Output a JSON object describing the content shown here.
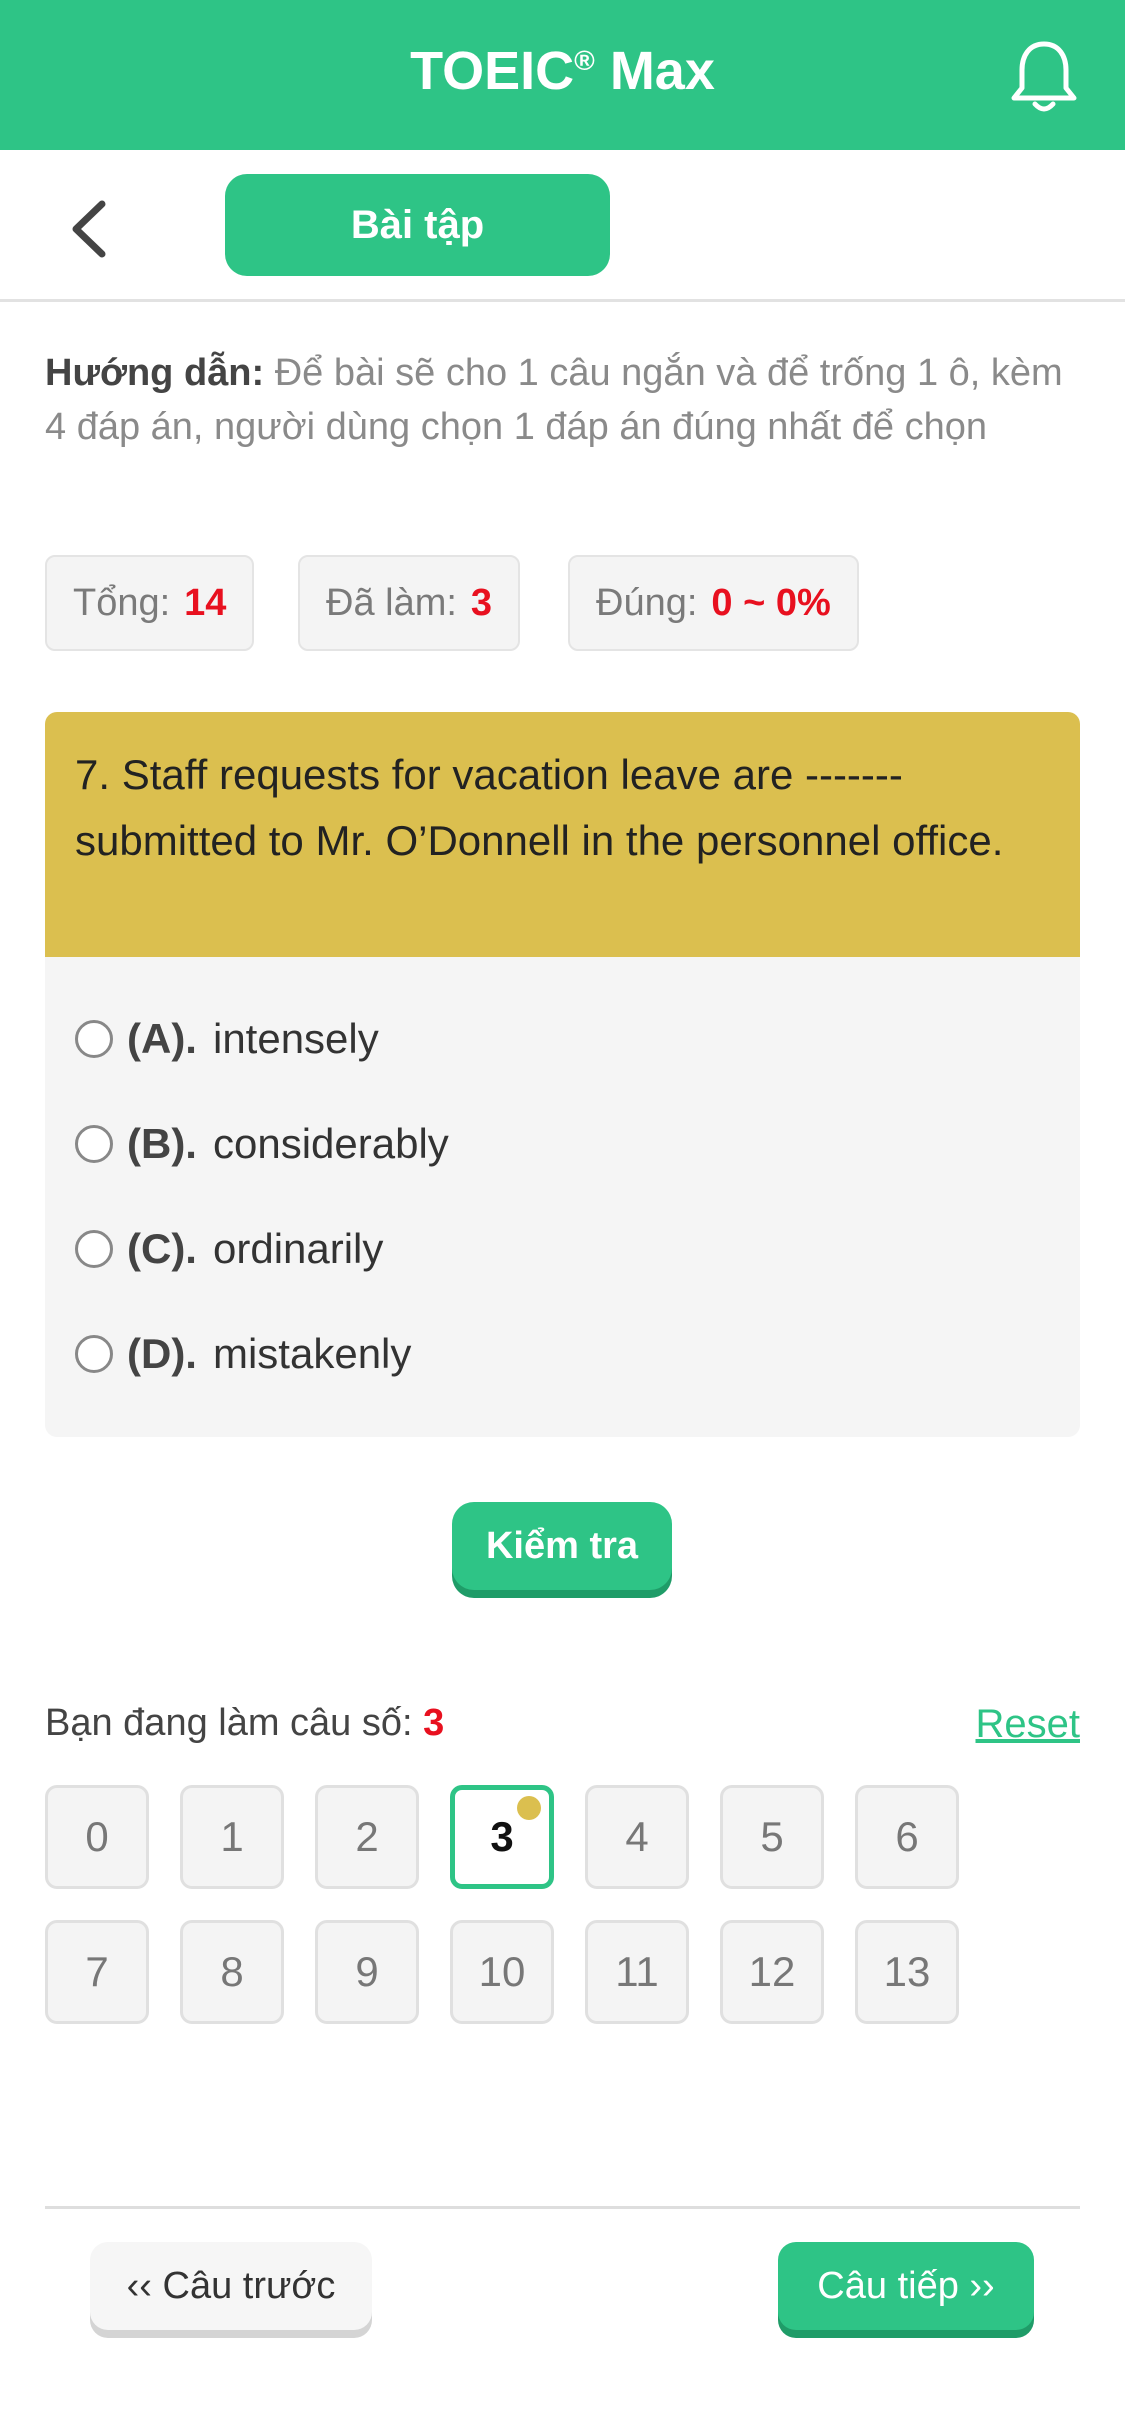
{
  "appbar": {
    "title": "TOEIC",
    "title_sup": "®",
    "title_suffix": "Max"
  },
  "subbar": {
    "tab_label": "Bài tập"
  },
  "guide": {
    "label": "Hướng dẫn:",
    "text": "Để bài sẽ cho 1 câu ngắn và để trống 1 ô, kèm 4 đáp án, người dùng chọn 1 đáp án đúng nhất để chọn"
  },
  "stats": {
    "total_label": "Tổng:",
    "total_value": "14",
    "done_label": "Đã làm:",
    "done_value": "3",
    "correct_label": "Đúng:",
    "correct_value": "0 ~ 0%"
  },
  "question": {
    "text": "7. Staff requests for vacation leave are ------- submitted to Mr. O’Donnell in the personnel office."
  },
  "options": [
    {
      "key": "(A).",
      "text": "intensely"
    },
    {
      "key": "(B).",
      "text": "considerably"
    },
    {
      "key": "(C).",
      "text": "ordinarily"
    },
    {
      "key": "(D).",
      "text": "mistakenly"
    }
  ],
  "check_button": "Kiểm tra",
  "current": {
    "label": "Bạn đang làm câu số:",
    "value": "3",
    "reset_label": "Reset"
  },
  "question_numbers": [
    "0",
    "1",
    "2",
    "3",
    "4",
    "5",
    "6",
    "7",
    "8",
    "9",
    "10",
    "11",
    "12",
    "13"
  ],
  "active_question": "3",
  "nav": {
    "prev_label": "‹‹ Câu trước",
    "next_label": "Câu tiếp ››"
  },
  "colors": {
    "primary": "#2ec486",
    "question_bg": "#dbbf4f",
    "highlight": "#e8101f"
  },
  "icons": {
    "bell": "bell-icon",
    "back": "chevron-left-icon"
  }
}
